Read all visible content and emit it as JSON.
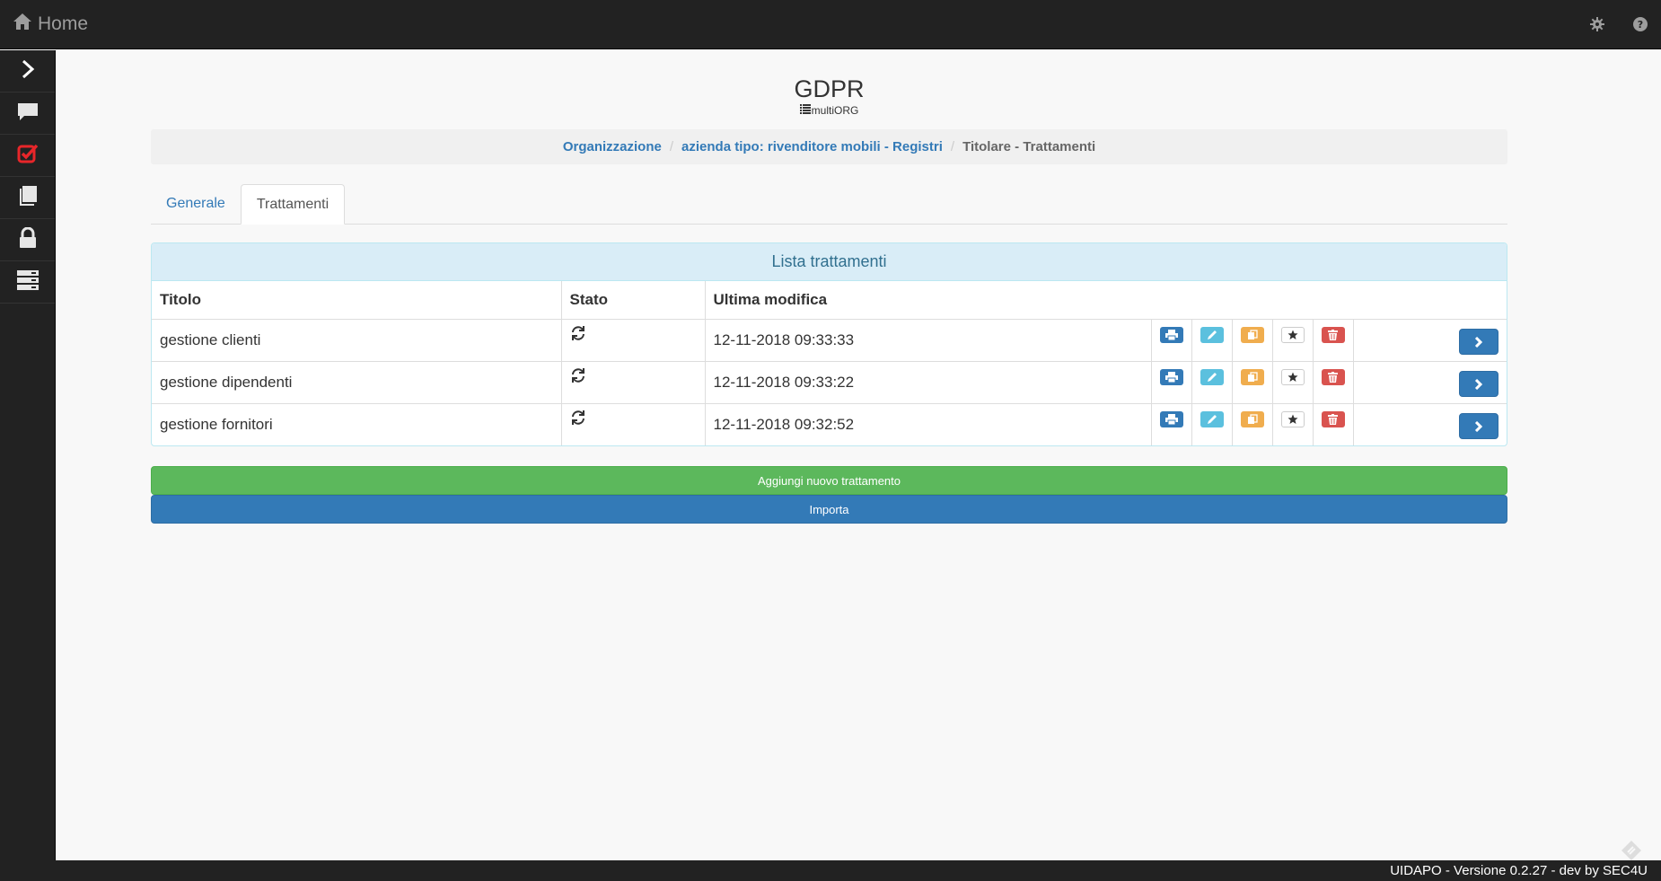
{
  "navbar": {
    "brand_label": "Home",
    "icons": [
      "home-icon",
      "gear-icon",
      "help-icon"
    ]
  },
  "sidebar": {
    "items": [
      {
        "icon": "chevron-right-icon"
      },
      {
        "icon": "comment-icon"
      },
      {
        "icon": "checkbox-icon",
        "color": "#e8262a"
      },
      {
        "icon": "book-icon"
      },
      {
        "icon": "lock-icon"
      },
      {
        "icon": "server-icon"
      }
    ]
  },
  "page": {
    "title": "GDPR",
    "subtitle": "multiORG"
  },
  "breadcrumb": {
    "items": [
      {
        "label": "Organizzazione"
      },
      {
        "label": "azienda tipo: rivenditore mobili - Registri"
      },
      {
        "label": "Titolare - Trattamenti"
      }
    ]
  },
  "tabs": [
    {
      "label": "Generale",
      "active": false
    },
    {
      "label": "Trattamenti",
      "active": true
    }
  ],
  "panel": {
    "heading": "Lista trattamenti",
    "columns": [
      "Titolo",
      "Stato",
      "Ultima modifica"
    ],
    "rows": [
      {
        "titolo": "gestione clienti",
        "stato_icon": "refresh-icon",
        "ultima_modifica": "12-11-2018 09:33:33"
      },
      {
        "titolo": "gestione dipendenti",
        "stato_icon": "refresh-icon",
        "ultima_modifica": "12-11-2018 09:33:22"
      },
      {
        "titolo": "gestione fornitori",
        "stato_icon": "refresh-icon",
        "ultima_modifica": "12-11-2018 09:32:52"
      }
    ],
    "row_actions": [
      "print-icon",
      "pencil-icon",
      "copy-icon",
      "star-icon",
      "trash-icon",
      "chevron-right-icon"
    ]
  },
  "buttons": {
    "add_label": "Aggiungi nuovo trattamento",
    "import_label": "Importa"
  },
  "colors": {
    "navbar": "#222222",
    "primary": "#337ab7",
    "success": "#5cb85c",
    "info": "#5bc0de",
    "warning": "#f0ad4e",
    "danger": "#d9534f"
  },
  "footer": {
    "text": "UIDAPO - Versione 0.2.27 - dev by SEC4U"
  }
}
